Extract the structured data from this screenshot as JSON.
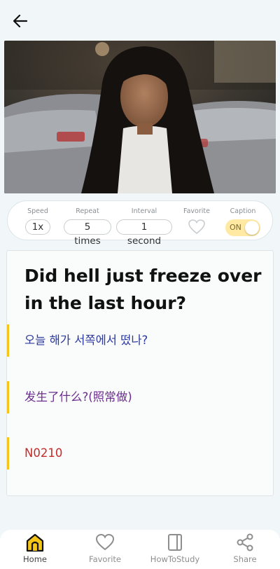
{
  "header": {
    "back_icon": "arrow-left-icon"
  },
  "video": {
    "description_icon": "video-still"
  },
  "controls": {
    "speed": {
      "label": "Speed",
      "value": "1x"
    },
    "repeat": {
      "label": "Repeat",
      "value": "5 times"
    },
    "interval": {
      "label": "Interval",
      "value": "1 second"
    },
    "favorite": {
      "label": "Favorite",
      "icon": "heart-outline-icon"
    },
    "caption": {
      "label": "Caption",
      "value": "ON"
    }
  },
  "card": {
    "sentence_line1": "Did hell just freeze over",
    "sentence_line2": "in the last hour?",
    "translations": [
      {
        "text": "오늘 해가 서쪽에서 떴나?",
        "color": "#2c3a9e"
      },
      {
        "text": "发生了什么?(照常做)",
        "color": "#6a2c8e"
      },
      {
        "text": "N0210",
        "color": "#c62b2b"
      }
    ],
    "accent": "#f5c518"
  },
  "nav": {
    "items": [
      {
        "label": "Home",
        "icon": "home-icon"
      },
      {
        "label": "Favorite",
        "icon": "heart-icon"
      },
      {
        "label": "HowToStudy",
        "icon": "book-icon"
      },
      {
        "label": "Share",
        "icon": "share-icon"
      }
    ],
    "active": "Home"
  }
}
